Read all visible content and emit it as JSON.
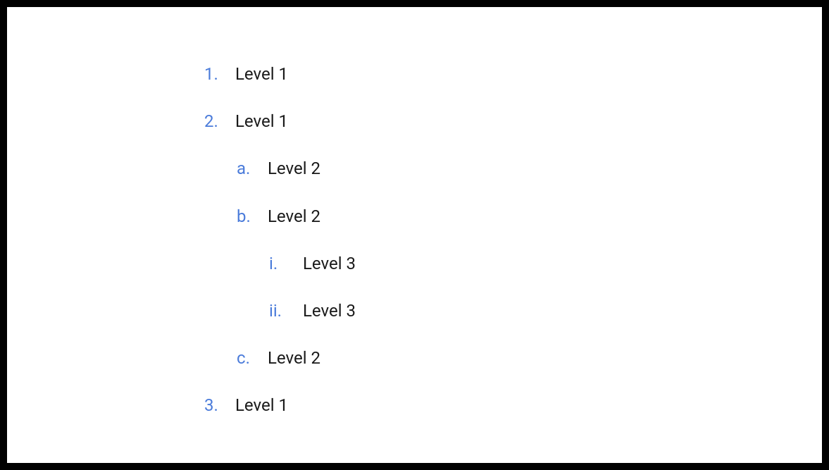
{
  "items": [
    {
      "marker": "1.",
      "text": "Level 1",
      "levelClass": "level-1"
    },
    {
      "marker": "2.",
      "text": "Level 1",
      "levelClass": "level-1"
    },
    {
      "marker": "a.",
      "text": "Level 2",
      "levelClass": "level-2"
    },
    {
      "marker": "b.",
      "text": "Level 2",
      "levelClass": "level-2"
    },
    {
      "marker": "i.",
      "text": "Level 3",
      "levelClass": "level-3"
    },
    {
      "marker": "ii.",
      "text": "Level 3",
      "levelClass": "level-3"
    },
    {
      "marker": "c.",
      "text": "Level 2",
      "levelClass": "level-2"
    },
    {
      "marker": "3.",
      "text": "Level 1",
      "levelClass": "level-1"
    }
  ]
}
